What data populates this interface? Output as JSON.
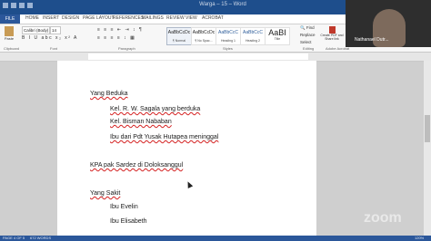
{
  "window": {
    "title": "Warga – 15 – Word"
  },
  "tabs": [
    "FILE",
    "HOME",
    "INSERT",
    "DESIGN",
    "PAGE LAYOUT",
    "REFERENCES",
    "MAILINGS",
    "REVIEW",
    "VIEW",
    "ACROBAT"
  ],
  "ribbon": {
    "paste_label": "Paste",
    "font_name": "Calibri (Body)",
    "font_size": "14",
    "styles": [
      {
        "sample": "AaBbCcDc",
        "name": "¶ Normal"
      },
      {
        "sample": "AaBbCcDc",
        "name": "¶ No Spac..."
      },
      {
        "sample": "AaBbCcC",
        "name": "Heading 1"
      },
      {
        "sample": "AaBbCcC",
        "name": "Heading 2"
      },
      {
        "sample": "AaBI",
        "name": "Title"
      }
    ],
    "find_label": "Find",
    "replace_label": "Replace",
    "select_label": "Select",
    "create_pdf_label": "Create PDF and Share link",
    "group_labels": {
      "clipboard": "Clipboard",
      "font": "Font",
      "paragraph": "Paragraph",
      "styles": "Styles",
      "editing": "Editing",
      "acrobat": "Adobe Acrobat"
    }
  },
  "document": {
    "lines": [
      "Yang Beduka",
      "Kel. R. W. Sagala yang berduka",
      "Kel. Bisman Nababan",
      "Ibu dari Pdt Yusak Hutapea meninggal",
      "KPA pak Sardez di Doloksanggul",
      "Yang Sakit",
      "Ibu Evelin",
      "Ibu Elisabeth"
    ]
  },
  "statusbar": {
    "page": "PAGE 4 OF 5",
    "words": "672 WORDS",
    "zoom": "120%"
  },
  "video": {
    "participant_name": "Nathanael Dutr..."
  },
  "watermark": "zoom"
}
